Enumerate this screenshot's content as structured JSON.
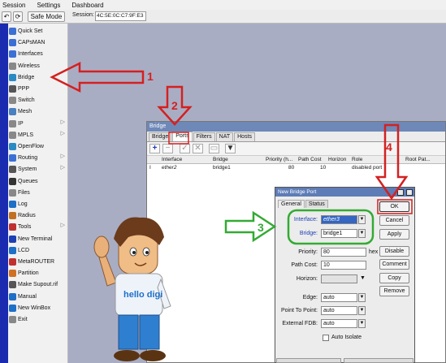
{
  "menubar": {
    "items": [
      "Session",
      "Settings",
      "Dashboard"
    ]
  },
  "toolbar": {
    "undo": "↶",
    "redo": "⟳",
    "safe_mode": "Safe Mode",
    "session_label": "Session:",
    "session_value": "4C:5E:0C:C7:9F:E3"
  },
  "sidebar": {
    "items": [
      {
        "label": "Quick Set",
        "icon": "quick-set-icon"
      },
      {
        "label": "CAPsMAN",
        "icon": "capsman-icon"
      },
      {
        "label": "Interfaces",
        "icon": "interfaces-icon"
      },
      {
        "label": "Wireless",
        "icon": "wireless-icon"
      },
      {
        "label": "Bridge",
        "icon": "bridge-icon"
      },
      {
        "label": "PPP",
        "icon": "ppp-icon"
      },
      {
        "label": "Switch",
        "icon": "switch-icon"
      },
      {
        "label": "Mesh",
        "icon": "mesh-icon"
      },
      {
        "label": "IP",
        "icon": "ip-icon",
        "arrow": "▷"
      },
      {
        "label": "MPLS",
        "icon": "mpls-icon",
        "arrow": "▷"
      },
      {
        "label": "OpenFlow",
        "icon": "openflow-icon"
      },
      {
        "label": "Routing",
        "icon": "routing-icon",
        "arrow": "▷"
      },
      {
        "label": "System",
        "icon": "system-icon",
        "arrow": "▷"
      },
      {
        "label": "Queues",
        "icon": "queues-icon"
      },
      {
        "label": "Files",
        "icon": "files-icon"
      },
      {
        "label": "Log",
        "icon": "log-icon"
      },
      {
        "label": "Radius",
        "icon": "radius-icon"
      },
      {
        "label": "Tools",
        "icon": "tools-icon",
        "arrow": "▷"
      },
      {
        "label": "New Terminal",
        "icon": "terminal-icon"
      },
      {
        "label": "LCD",
        "icon": "lcd-icon"
      },
      {
        "label": "MetaROUTER",
        "icon": "metarouter-icon"
      },
      {
        "label": "Partition",
        "icon": "partition-icon"
      },
      {
        "label": "Make Supout.rif",
        "icon": "supout-icon"
      },
      {
        "label": "Manual",
        "icon": "manual-icon"
      },
      {
        "label": "New WinBox",
        "icon": "winbox-icon"
      },
      {
        "label": "Exit",
        "icon": "exit-icon"
      }
    ]
  },
  "bridge_window": {
    "title": "Bridge",
    "tabs": [
      "Bridge",
      "Ports",
      "Filters",
      "NAT",
      "Hosts"
    ],
    "active_tab": "Ports",
    "columns": [
      "Interface",
      "Bridge",
      "Priority (h...",
      "Path Cost",
      "Horizon",
      "Role",
      "Root Pat..."
    ],
    "rows": [
      {
        "flag": "I",
        "interface": "ether2",
        "bridge": "bridge1",
        "priority": "80",
        "path_cost": "10",
        "horizon": "",
        "role": "disabled port",
        "root_path": ""
      }
    ]
  },
  "dialog": {
    "title": "New Bridge Port",
    "tabs": [
      "General",
      "Status"
    ],
    "fields": {
      "interface_label": "Interface:",
      "interface_value": "ether3",
      "bridge_label": "Bridge:",
      "bridge_value": "bridge1",
      "priority_label": "Priority:",
      "priority_value": "80",
      "priority_unit": "hex",
      "path_cost_label": "Path Cost:",
      "path_cost_value": "10",
      "horizon_label": "Horizon:",
      "horizon_value": "",
      "edge_label": "Edge:",
      "edge_value": "auto",
      "p2p_label": "Point To Point:",
      "p2p_value": "auto",
      "fdb_label": "External FDB:",
      "fdb_value": "auto",
      "auto_isolate_label": "Auto Isolate"
    },
    "buttons": [
      "OK",
      "Cancel",
      "Apply",
      "Disable",
      "Comment",
      "Copy",
      "Remove"
    ]
  },
  "annotations": {
    "n1": "1",
    "n2": "2",
    "n3": "3",
    "n4": "4"
  },
  "mascot": {
    "shirt_text": "hello digi"
  },
  "colors": {
    "arrow_red": "#d42020",
    "arrow_green": "#33aa33",
    "title_blue": "#5e7cb6"
  }
}
